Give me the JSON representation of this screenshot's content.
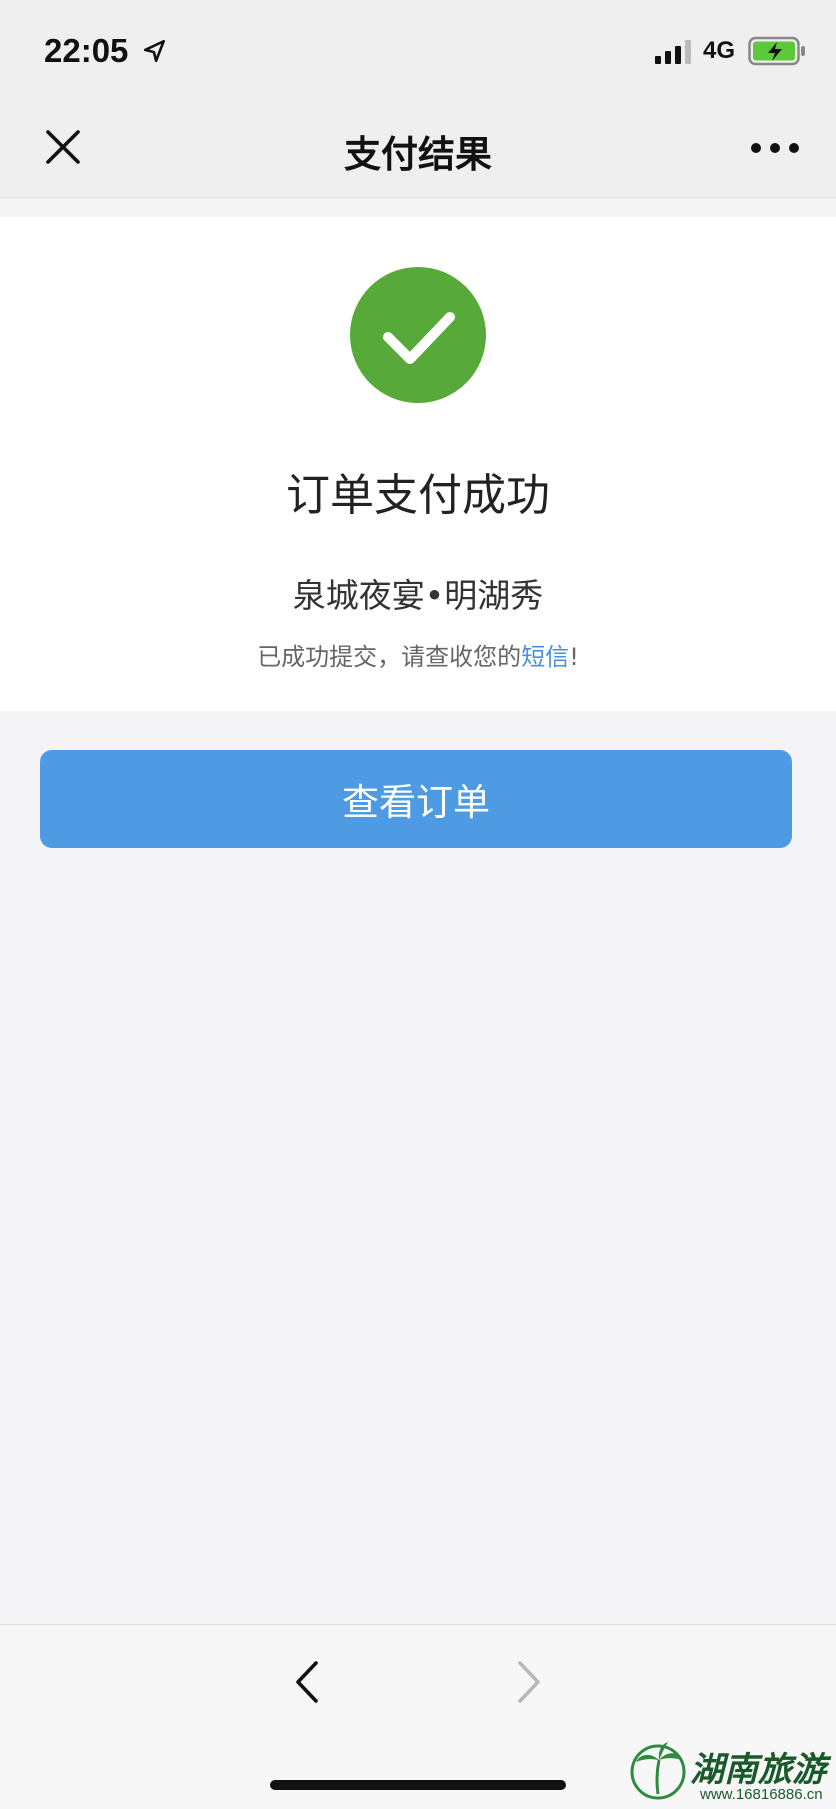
{
  "status_bar": {
    "time": "22:05",
    "network": "4G",
    "icons": [
      "location-arrow-icon",
      "signal-icon",
      "battery-charging-icon"
    ]
  },
  "nav": {
    "title": "支付结果",
    "close_icon": "close-icon",
    "more_icon": "more-icon"
  },
  "result": {
    "status_icon": "check-circle-icon",
    "title": "订单支付成功",
    "product_name": "泉城夜宴•明湖秀",
    "note_prefix": "已成功提交，请查收您的",
    "note_link": "短信",
    "note_suffix": "!"
  },
  "actions": {
    "view_order_label": "查看订单"
  },
  "toolbar": {
    "back_icon": "chevron-left-icon",
    "forward_icon": "chevron-right-icon"
  },
  "watermark": {
    "text": "湖南旅游",
    "url": "www.16816886.cn"
  },
  "colors": {
    "success": "#57a93a",
    "primary": "#4e9ae3",
    "link": "#4a90d9",
    "background": "#f4f4f6"
  }
}
